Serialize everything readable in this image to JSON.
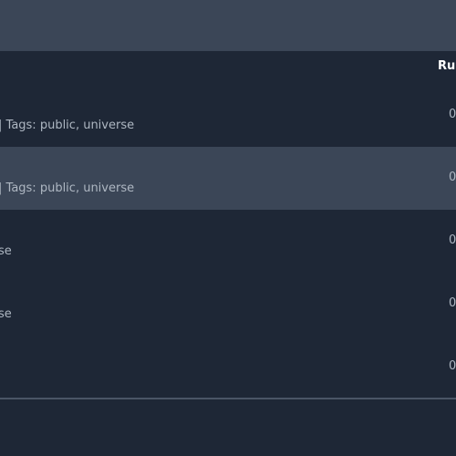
{
  "table": {
    "columns": {
      "runs_label": "Run"
    },
    "rows": [
      {
        "subtitle_prefix": "|",
        "subtitle_tags": "Tags: public, universe",
        "runs": "0"
      },
      {
        "subtitle_prefix": "|",
        "subtitle_tags": "Tags: public, universe",
        "runs": "0"
      },
      {
        "subtitle_prefix": "",
        "subtitle_tags": "se",
        "runs": "0"
      },
      {
        "subtitle_prefix": "",
        "subtitle_tags": "se",
        "runs": "0"
      },
      {
        "subtitle_prefix": "",
        "subtitle_tags": "",
        "runs": "0"
      }
    ]
  },
  "colors": {
    "background": "#1e2736",
    "highlight_row": "#3b4657",
    "divider": "#313c4c",
    "header_text": "#ffffff",
    "muted_text": "#aeb7c2"
  }
}
